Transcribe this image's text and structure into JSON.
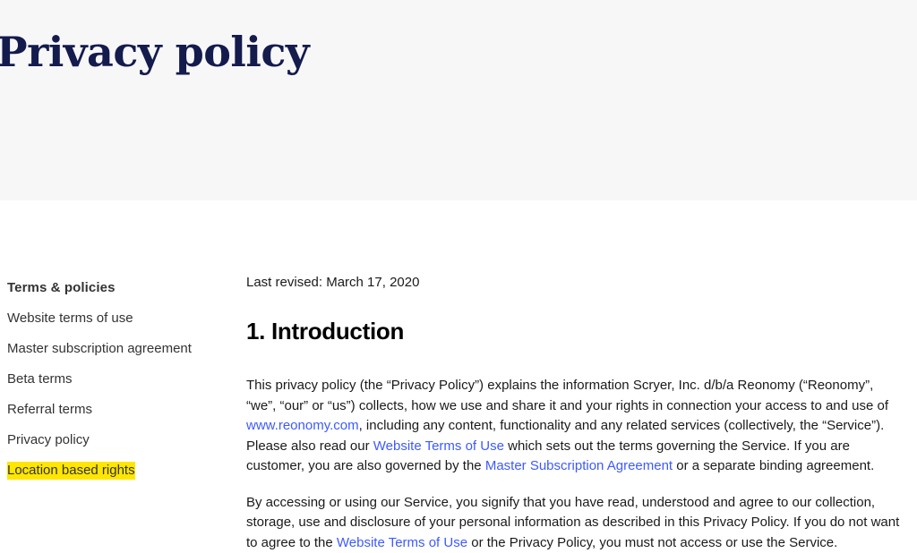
{
  "hero": {
    "title": "Privacy policy",
    "background_color": "#f7f7f7",
    "title_color": "#141b4d"
  },
  "sidebar": {
    "heading": "Terms & policies",
    "items": [
      {
        "label": "Website terms of use",
        "highlighted": false
      },
      {
        "label": "Master subscription agreement",
        "highlighted": false
      },
      {
        "label": "Beta terms",
        "highlighted": false
      },
      {
        "label": "Referral terms",
        "highlighted": false
      },
      {
        "label": "Privacy policy",
        "highlighted": false
      },
      {
        "label": "Location based rights",
        "highlighted": true
      }
    ],
    "highlight_color": "#ffe600"
  },
  "content": {
    "last_revised": "Last revised: March 17, 2020",
    "section_heading": "1. Introduction",
    "link_color": "#3d5afe",
    "paragraph_1": {
      "part_1": "This privacy policy (the “Privacy Policy”) explains the information Scryer, Inc. d/b/a Reonomy (“Reonomy”, “we”, “our” or “us”) collects, how we use and share it and your rights in connection your access to and use of ",
      "link_1": "www.reonomy.com",
      "part_2": ", including any content, functionality and any related services (collectively, the “Service”). Please also read our ",
      "link_2": "Website Terms of Use",
      "part_3": " which sets out the terms governing the Service. If you are customer, you are also governed by the ",
      "link_3": "Master Subscription Agreement",
      "part_4": " or a separate binding agreement."
    },
    "paragraph_2": {
      "part_1": "By accessing or using our Service, you signify that you have read, understood and agree to our collection, storage, use and disclosure of your personal information as described in this Privacy Policy. If you do not want to agree to the ",
      "link_1": "Website Terms of Use",
      "part_2": " or the Privacy Policy, you must not access or use the Service."
    }
  }
}
